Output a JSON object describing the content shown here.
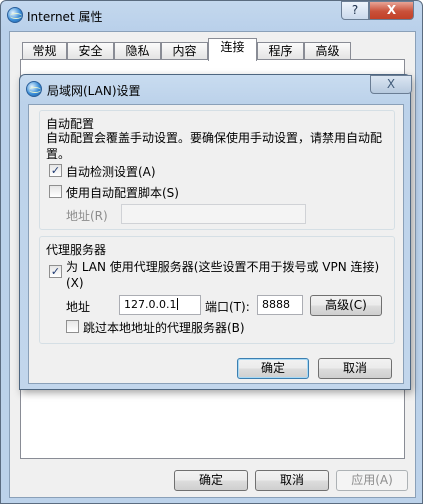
{
  "window": {
    "title": "Internet 属性",
    "help_label": "?",
    "close_label": "X"
  },
  "tabs": [
    {
      "label": "常规"
    },
    {
      "label": "安全"
    },
    {
      "label": "隐私"
    },
    {
      "label": "内容"
    },
    {
      "label": "连接",
      "active": true
    },
    {
      "label": "程序"
    },
    {
      "label": "高级"
    }
  ],
  "footer": {
    "ok_label": "确定",
    "cancel_label": "取消",
    "apply_label": "应用(A)"
  },
  "lan_dialog": {
    "title": "局域网(LAN)设置",
    "close_label": "X",
    "auto_config": {
      "heading": "自动配置",
      "description": "自动配置会覆盖手动设置。要确保使用手动设置，请禁用自动配置。",
      "auto_detect_label": "自动检测设置(A)",
      "auto_detect_checked": true,
      "use_script_label": "使用自动配置脚本(S)",
      "use_script_checked": false,
      "address_label": "地址(R)",
      "address_value": ""
    },
    "proxy": {
      "heading": "代理服务器",
      "use_proxy_label": "为 LAN 使用代理服务器(这些设置不用于拨号或 VPN 连接)(X)",
      "use_proxy_checked": true,
      "address_label": "地址",
      "address_value": "127.0.0.1",
      "port_label": "端口(T):",
      "port_value": "8888",
      "advanced_label": "高级(C)",
      "bypass_label": "跳过本地地址的代理服务器(B)",
      "bypass_checked": false
    },
    "ok_label": "确定",
    "cancel_label": "取消"
  },
  "colors": {
    "title_bar": "#bcd2ea",
    "close_button": "#c24128",
    "check_mark": "#1f3a72"
  }
}
